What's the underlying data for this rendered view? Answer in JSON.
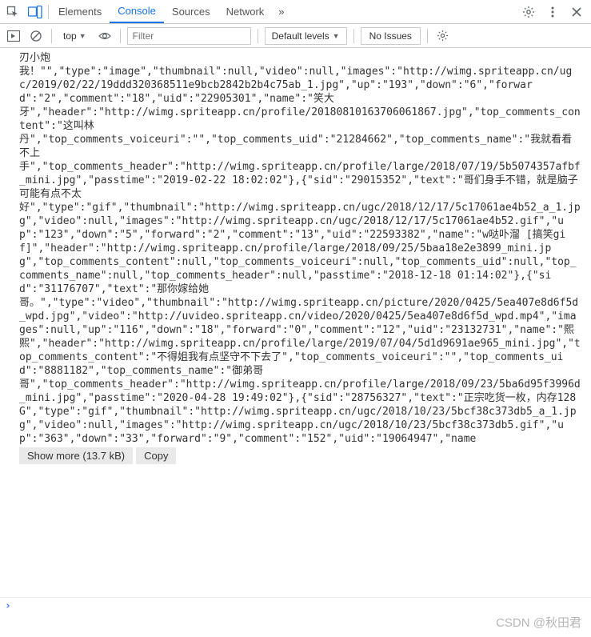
{
  "tabs": {
    "elements": "Elements",
    "console": "Console",
    "sources": "Sources",
    "network": "Network",
    "more": "»"
  },
  "subbar": {
    "context": "top",
    "filter_placeholder": "Filter",
    "levels": "Default levels",
    "issues": "No Issues"
  },
  "console": {
    "text": "刃小炮\n我！\"\",\"type\":\"image\",\"thumbnail\":null,\"video\":null,\"images\":\"http://wimg.spriteapp.cn/ugc/2019/02/22/19ddd320368511e9bcb2842b2b4c75ab_1.jpg\",\"up\":\"193\",\"down\":\"6\",\"forward\":\"2\",\"comment\":\"18\",\"uid\":\"22905301\",\"name\":\"笑大\n牙\",\"header\":\"http://wimg.spriteapp.cn/profile/20180810163706061867.jpg\",\"top_comments_content\":\"这叫林\n丹\",\"top_comments_voiceuri\":\"\",\"top_comments_uid\":\"21284662\",\"top_comments_name\":\"我就看看不上\n手\",\"top_comments_header\":\"http://wimg.spriteapp.cn/profile/large/2018/07/19/5b5074357afbf_mini.jpg\",\"passtime\":\"2019-02-22 18:02:02\"},{\"sid\":\"29015352\",\"text\":\"哥们身手不错，就是脑子可能有点不太\n好\",\"type\":\"gif\",\"thumbnail\":\"http://wimg.spriteapp.cn/ugc/2018/12/17/5c17061ae4b52_a_1.jpg\",\"video\":null,\"images\":\"http://wimg.spriteapp.cn/ugc/2018/12/17/5c17061ae4b52.gif\",\"up\":\"123\",\"down\":\"5\",\"forward\":\"2\",\"comment\":\"13\",\"uid\":\"22593382\",\"name\":\"w哒卟溜 [搞笑gif]\",\"header\":\"http://wimg.spriteapp.cn/profile/large/2018/09/25/5baa18e2e3899_mini.jpg\",\"top_comments_content\":null,\"top_comments_voiceuri\":null,\"top_comments_uid\":null,\"top_comments_name\":null,\"top_comments_header\":null,\"passtime\":\"2018-12-18 01:14:02\"},{\"sid\":\"31176707\",\"text\":\"那你嫁给她\n哥。\",\"type\":\"video\",\"thumbnail\":\"http://wimg.spriteapp.cn/picture/2020/0425/5ea407e8d6f5d_wpd.jpg\",\"video\":\"http://uvideo.spriteapp.cn/video/2020/0425/5ea407e8d6f5d_wpd.mp4\",\"images\":null,\"up\":\"116\",\"down\":\"18\",\"forward\":\"0\",\"comment\":\"12\",\"uid\":\"23132731\",\"name\":\"熙熙\",\"header\":\"http://wimg.spriteapp.cn/profile/large/2019/07/04/5d1d9691ae965_mini.jpg\",\"top_comments_content\":\"不得姐我有点坚守不下去了\",\"top_comments_voiceuri\":\"\",\"top_comments_uid\":\"8881182\",\"top_comments_name\":\"御弟哥\n哥\",\"top_comments_header\":\"http://wimg.spriteapp.cn/profile/large/2018/09/23/5ba6d95f3996d_mini.jpg\",\"passtime\":\"2020-04-28 19:49:02\"},{\"sid\":\"28756327\",\"text\":\"正宗吃货一枚，内存128G\",\"type\":\"gif\",\"thumbnail\":\"http://wimg.spriteapp.cn/ugc/2018/10/23/5bcf38c373db5_a_1.jpg\",\"video\":null,\"images\":\"http://wimg.spriteapp.cn/ugc/2018/10/23/5bcf38c373db5.gif\",\"up\":\"363\",\"down\":\"33\",\"forward\":\"9\",\"comment\":\"152\",\"uid\":\"19064947\",\"name",
    "showmore": "Show more (13.7 kB)",
    "copy": "Copy"
  },
  "watermark": "CSDN @秋田君"
}
